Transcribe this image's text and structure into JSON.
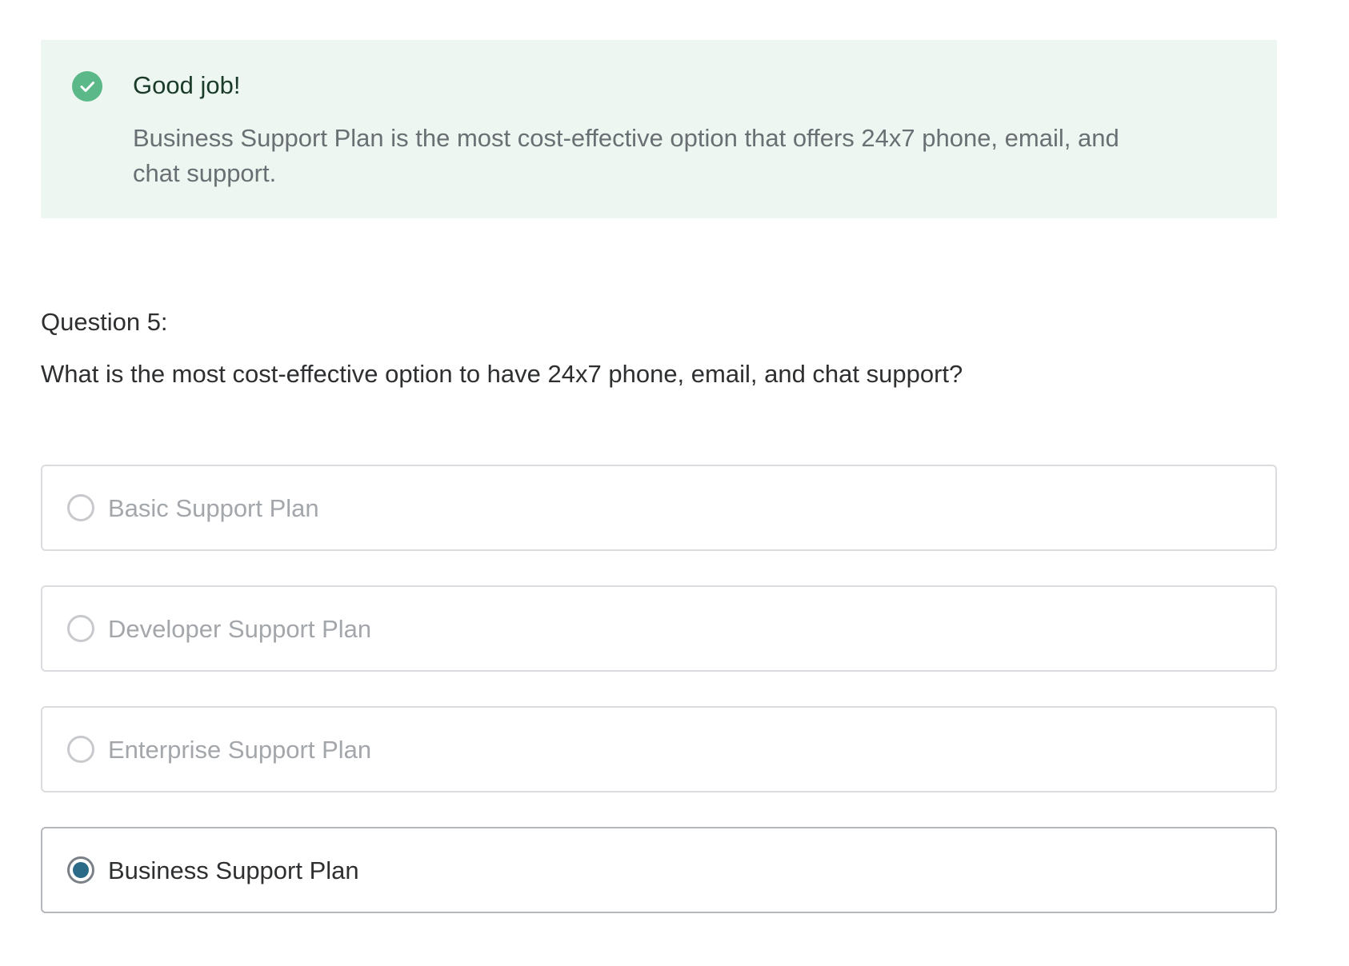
{
  "feedback": {
    "title": "Good job!",
    "explanation": "Business Support Plan is the most cost-effective option that offers 24x7 phone, email, and chat support.",
    "icon": "check-circle-icon",
    "accent_color": "#5bb889",
    "background_color": "#edf6f1"
  },
  "question": {
    "label": "Question 5:",
    "text": "What is the most cost-effective option to have 24x7 phone, email, and chat support?"
  },
  "options": [
    {
      "label": "Basic Support Plan",
      "selected": false
    },
    {
      "label": "Developer Support Plan",
      "selected": false
    },
    {
      "label": "Enterprise Support Plan",
      "selected": false
    },
    {
      "label": "Business Support Plan",
      "selected": true
    }
  ],
  "colors": {
    "selected_radio": "#2b6b88",
    "unselected_text": "#a3a6aa",
    "text": "#2d2f31"
  }
}
